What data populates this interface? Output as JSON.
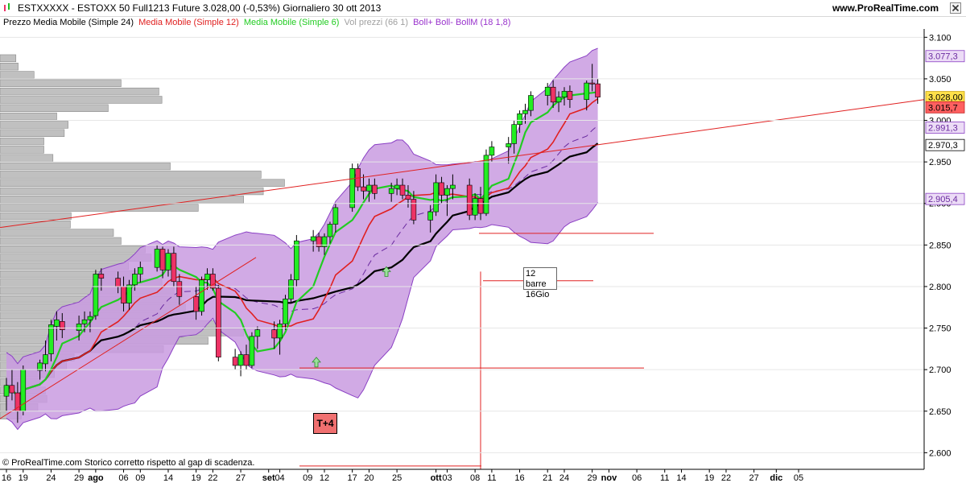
{
  "window": {
    "title": "ESTXXXXX - ESTOXX 50 Full1213 Future    3.028,00 (-0,53%)    Giornaliero  30 ott 2013",
    "site": "www.ProRealTime.com"
  },
  "legend": [
    {
      "text": "Prezzo Media Mobile (Simple 24)",
      "color": "#000000"
    },
    {
      "text": "Media Mobile (Simple 12)",
      "color": "#e02020"
    },
    {
      "text": "Media Mobile (Simple 6)",
      "color": "#22cc22"
    },
    {
      "text": "Vol prezzi (66 1)",
      "color": "#a0a0a0"
    },
    {
      "text": "Boll+ Boll- BollM (18 1,8)",
      "color": "#9933cc"
    }
  ],
  "footer_note": "© ProRealTime.com  Storico corretto rispetto al gap di scadenza.",
  "annotations": {
    "bars_box_line1": "12 barre",
    "bars_box_line2": "16Gio",
    "tplus": "T+4"
  },
  "colors": {
    "up": "#22ee22",
    "down": "#ee3366",
    "band_fill": "#c99be0",
    "band_line": "#8a3fc4",
    "sma6": "#22cc22",
    "sma12": "#e02020",
    "sma24": "#000000",
    "volume": "#c0c0c0",
    "trendline": "#e02020"
  },
  "chart_data": {
    "type": "candlestick",
    "y_axis": {
      "min": 2580,
      "max": 3110,
      "ticks": [
        2600,
        2650,
        2700,
        2750,
        2800,
        2850,
        2900,
        2950,
        3000,
        3050,
        3100
      ],
      "tick_labels": [
        "2.600",
        "2.650",
        "2.700",
        "2.750",
        "2.800",
        "2.850",
        "2.900",
        "2.950",
        "3.000",
        "3.050",
        "3.100"
      ]
    },
    "x_axis": {
      "labels": [
        {
          "text": "16",
          "day": 0
        },
        {
          "text": "19",
          "day": 3
        },
        {
          "text": "24",
          "day": 8
        },
        {
          "text": "29",
          "day": 13
        },
        {
          "text": "ago",
          "day": 16,
          "bold": true
        },
        {
          "text": "06",
          "day": 21
        },
        {
          "text": "09",
          "day": 24
        },
        {
          "text": "14",
          "day": 29
        },
        {
          "text": "19",
          "day": 34
        },
        {
          "text": "22",
          "day": 37
        },
        {
          "text": "27",
          "day": 42
        },
        {
          "text": "set",
          "day": 47,
          "bold": true
        },
        {
          "text": "04",
          "day": 49
        },
        {
          "text": "09",
          "day": 54
        },
        {
          "text": "12",
          "day": 57
        },
        {
          "text": "17",
          "day": 62
        },
        {
          "text": "20",
          "day": 65
        },
        {
          "text": "25",
          "day": 70
        },
        {
          "text": "ott",
          "day": 77,
          "bold": true
        },
        {
          "text": "03",
          "day": 79
        },
        {
          "text": "08",
          "day": 84
        },
        {
          "text": "11",
          "day": 87
        },
        {
          "text": "16",
          "day": 92
        },
        {
          "text": "21",
          "day": 97
        },
        {
          "text": "24",
          "day": 100
        },
        {
          "text": "29",
          "day": 105
        },
        {
          "text": "nov",
          "day": 108,
          "bold": true
        },
        {
          "text": "06",
          "day": 113
        },
        {
          "text": "11",
          "day": 118
        },
        {
          "text": "14",
          "day": 121
        },
        {
          "text": "19",
          "day": 126
        },
        {
          "text": "22",
          "day": 129
        },
        {
          "text": "27",
          "day": 134
        },
        {
          "text": "dic",
          "day": 138,
          "bold": true
        },
        {
          "text": "05",
          "day": 142
        }
      ],
      "start_date": "16 lug 2013"
    },
    "price_labels": [
      {
        "value": 3077.3,
        "text": "3.077,3",
        "style": "boll"
      },
      {
        "value": 3028.0,
        "text": "3.028,00",
        "style": "price"
      },
      {
        "value": 3015.7,
        "text": "3.015,7",
        "style": "sma"
      },
      {
        "value": 2991.3,
        "text": "2.991,3",
        "style": "boll"
      },
      {
        "value": 2970.3,
        "text": "2.970,3",
        "style": "plain"
      },
      {
        "value": 2905.4,
        "text": "2.905,4",
        "style": "boll"
      }
    ],
    "candles": [
      {
        "date": "16 lug",
        "o": 2668,
        "h": 2690,
        "l": 2650,
        "c": 2681
      },
      {
        "date": "17 lug",
        "o": 2681,
        "h": 2700,
        "l": 2663,
        "c": 2672
      },
      {
        "date": "18 lug",
        "o": 2672,
        "h": 2685,
        "l": 2636,
        "c": 2650
      },
      {
        "date": "19 lug",
        "o": 2650,
        "h": 2705,
        "l": 2645,
        "c": 2700
      },
      {
        "date": "22 lug",
        "o": 2699,
        "h": 2712,
        "l": 2688,
        "c": 2708
      },
      {
        "date": "23 lug",
        "o": 2707,
        "h": 2735,
        "l": 2698,
        "c": 2718
      },
      {
        "date": "24 lug",
        "o": 2719,
        "h": 2760,
        "l": 2710,
        "c": 2754
      },
      {
        "date": "25 lug",
        "o": 2752,
        "h": 2770,
        "l": 2735,
        "c": 2760
      },
      {
        "date": "26 lug",
        "o": 2758,
        "h": 2768,
        "l": 2738,
        "c": 2748
      },
      {
        "date": "29 lug",
        "o": 2747,
        "h": 2765,
        "l": 2735,
        "c": 2755
      },
      {
        "date": "30 lug",
        "o": 2755,
        "h": 2770,
        "l": 2745,
        "c": 2760
      },
      {
        "date": "31 lug",
        "o": 2760,
        "h": 2770,
        "l": 2745,
        "c": 2764
      },
      {
        "date": "01 ago",
        "o": 2765,
        "h": 2820,
        "l": 2760,
        "c": 2815
      },
      {
        "date": "02 ago",
        "o": 2815,
        "h": 2822,
        "l": 2795,
        "c": 2810
      },
      {
        "date": "05 ago",
        "o": 2810,
        "h": 2818,
        "l": 2792,
        "c": 2800
      },
      {
        "date": "06 ago",
        "o": 2800,
        "h": 2812,
        "l": 2770,
        "c": 2780
      },
      {
        "date": "07 ago",
        "o": 2780,
        "h": 2808,
        "l": 2772,
        "c": 2802
      },
      {
        "date": "08 ago",
        "o": 2802,
        "h": 2822,
        "l": 2795,
        "c": 2815
      },
      {
        "date": "09 ago",
        "o": 2815,
        "h": 2830,
        "l": 2805,
        "c": 2823
      },
      {
        "date": "12 ago",
        "o": 2823,
        "h": 2850,
        "l": 2818,
        "c": 2845
      },
      {
        "date": "13 ago",
        "o": 2845,
        "h": 2848,
        "l": 2810,
        "c": 2820
      },
      {
        "date": "14 ago",
        "o": 2820,
        "h": 2845,
        "l": 2812,
        "c": 2840
      },
      {
        "date": "15 ago",
        "o": 2840,
        "h": 2848,
        "l": 2800,
        "c": 2806
      },
      {
        "date": "16 ago",
        "o": 2806,
        "h": 2815,
        "l": 2778,
        "c": 2788
      },
      {
        "date": "19 ago",
        "o": 2788,
        "h": 2800,
        "l": 2760,
        "c": 2770
      },
      {
        "date": "20 ago",
        "o": 2770,
        "h": 2812,
        "l": 2765,
        "c": 2808
      },
      {
        "date": "21 ago",
        "o": 2808,
        "h": 2822,
        "l": 2796,
        "c": 2815
      },
      {
        "date": "22 ago",
        "o": 2815,
        "h": 2822,
        "l": 2795,
        "c": 2798
      },
      {
        "date": "23 ago",
        "o": 2798,
        "h": 2802,
        "l": 2710,
        "c": 2715
      },
      {
        "date": "26 ago",
        "o": 2715,
        "h": 2725,
        "l": 2700,
        "c": 2705
      },
      {
        "date": "27 ago",
        "o": 2705,
        "h": 2722,
        "l": 2692,
        "c": 2718
      },
      {
        "date": "28 ago",
        "o": 2718,
        "h": 2730,
        "l": 2700,
        "c": 2705
      },
      {
        "date": "29 ago",
        "o": 2705,
        "h": 2745,
        "l": 2702,
        "c": 2740
      },
      {
        "date": "30 ago",
        "o": 2740,
        "h": 2752,
        "l": 2725,
        "c": 2748
      },
      {
        "date": "02 set",
        "o": 2748,
        "h": 2758,
        "l": 2725,
        "c": 2738
      },
      {
        "date": "03 set",
        "o": 2738,
        "h": 2760,
        "l": 2718,
        "c": 2755
      },
      {
        "date": "04 set",
        "o": 2755,
        "h": 2790,
        "l": 2748,
        "c": 2785
      },
      {
        "date": "05 set",
        "o": 2785,
        "h": 2815,
        "l": 2780,
        "c": 2808
      },
      {
        "date": "06 set",
        "o": 2808,
        "h": 2862,
        "l": 2800,
        "c": 2855
      },
      {
        "date": "09 set",
        "o": 2855,
        "h": 2868,
        "l": 2842,
        "c": 2860
      },
      {
        "date": "10 set",
        "o": 2860,
        "h": 2865,
        "l": 2842,
        "c": 2848
      },
      {
        "date": "11 set",
        "o": 2848,
        "h": 2864,
        "l": 2838,
        "c": 2860
      },
      {
        "date": "12 set",
        "o": 2860,
        "h": 2878,
        "l": 2852,
        "c": 2875
      },
      {
        "date": "13 set",
        "o": 2875,
        "h": 2900,
        "l": 2865,
        "c": 2895
      },
      {
        "date": "16 set",
        "o": 2895,
        "h": 2948,
        "l": 2890,
        "c": 2942
      },
      {
        "date": "17 set",
        "o": 2942,
        "h": 2948,
        "l": 2915,
        "c": 2920
      },
      {
        "date": "18 set",
        "o": 2920,
        "h": 2935,
        "l": 2905,
        "c": 2915
      },
      {
        "date": "19 set",
        "o": 2915,
        "h": 2930,
        "l": 2902,
        "c": 2922
      },
      {
        "date": "20 set",
        "o": 2922,
        "h": 2930,
        "l": 2905,
        "c": 2912
      },
      {
        "date": "23 set",
        "o": 2912,
        "h": 2925,
        "l": 2902,
        "c": 2918
      },
      {
        "date": "24 set",
        "o": 2918,
        "h": 2930,
        "l": 2910,
        "c": 2922
      },
      {
        "date": "25 set",
        "o": 2922,
        "h": 2930,
        "l": 2905,
        "c": 2910
      },
      {
        "date": "26 set",
        "o": 2910,
        "h": 2922,
        "l": 2895,
        "c": 2905
      },
      {
        "date": "27 set",
        "o": 2905,
        "h": 2915,
        "l": 2875,
        "c": 2880
      },
      {
        "date": "30 set",
        "o": 2880,
        "h": 2898,
        "l": 2865,
        "c": 2890
      },
      {
        "date": "01 ott",
        "o": 2890,
        "h": 2935,
        "l": 2885,
        "c": 2925
      },
      {
        "date": "02 ott",
        "o": 2925,
        "h": 2932,
        "l": 2900,
        "c": 2910
      },
      {
        "date": "03 ott",
        "o": 2910,
        "h": 2922,
        "l": 2885,
        "c": 2918
      },
      {
        "date": "04 ott",
        "o": 2918,
        "h": 2935,
        "l": 2905,
        "c": 2922
      },
      {
        "date": "07 ott",
        "o": 2922,
        "h": 2930,
        "l": 2880,
        "c": 2886
      },
      {
        "date": "08 ott",
        "o": 2886,
        "h": 2912,
        "l": 2880,
        "c": 2906
      },
      {
        "date": "09 ott",
        "o": 2906,
        "h": 2920,
        "l": 2880,
        "c": 2888
      },
      {
        "date": "10 ott",
        "o": 2888,
        "h": 2965,
        "l": 2885,
        "c": 2958
      },
      {
        "date": "11 ott",
        "o": 2958,
        "h": 2975,
        "l": 2950,
        "c": 2968
      },
      {
        "date": "14 ott",
        "o": 2968,
        "h": 2980,
        "l": 2948,
        "c": 2972
      },
      {
        "date": "15 ott",
        "o": 2972,
        "h": 3000,
        "l": 2960,
        "c": 2995
      },
      {
        "date": "16 ott",
        "o": 2995,
        "h": 3012,
        "l": 2985,
        "c": 3008
      },
      {
        "date": "17 ott",
        "o": 3008,
        "h": 3020,
        "l": 2996,
        "c": 3012
      },
      {
        "date": "18 ott",
        "o": 3012,
        "h": 3035,
        "l": 3005,
        "c": 3030
      },
      {
        "date": "21 ott",
        "o": 3030,
        "h": 3045,
        "l": 3018,
        "c": 3040
      },
      {
        "date": "22 ott",
        "o": 3040,
        "h": 3048,
        "l": 3015,
        "c": 3022
      },
      {
        "date": "23 ott",
        "o": 3022,
        "h": 3035,
        "l": 3010,
        "c": 3028
      },
      {
        "date": "24 ott",
        "o": 3028,
        "h": 3040,
        "l": 3018,
        "c": 3035
      },
      {
        "date": "25 ott",
        "o": 3035,
        "h": 3042,
        "l": 3015,
        "c": 3025
      },
      {
        "date": "28 ott",
        "o": 3025,
        "h": 3048,
        "l": 3012,
        "c": 3045
      },
      {
        "date": "29 ott",
        "o": 3045,
        "h": 3068,
        "l": 3035,
        "c": 3044
      },
      {
        "date": "30 ott",
        "o": 3044,
        "h": 3050,
        "l": 3020,
        "c": 3028
      }
    ],
    "volume_profile": [
      {
        "price": 3075,
        "volume": 21
      },
      {
        "price": 3065,
        "volume": 24
      },
      {
        "price": 3055,
        "volume": 45
      },
      {
        "price": 3045,
        "volume": 160
      },
      {
        "price": 3035,
        "volume": 210
      },
      {
        "price": 3025,
        "volume": 214
      },
      {
        "price": 3015,
        "volume": 143
      },
      {
        "price": 3005,
        "volume": 75
      },
      {
        "price": 2995,
        "volume": 90
      },
      {
        "price": 2985,
        "volume": 85
      },
      {
        "price": 2975,
        "volume": 58
      },
      {
        "price": 2965,
        "volume": 58
      },
      {
        "price": 2955,
        "volume": 70
      },
      {
        "price": 2945,
        "volume": 225
      },
      {
        "price": 2935,
        "volume": 345
      },
      {
        "price": 2925,
        "volume": 376
      },
      {
        "price": 2915,
        "volume": 348
      },
      {
        "price": 2905,
        "volume": 322
      },
      {
        "price": 2895,
        "volume": 262
      },
      {
        "price": 2885,
        "volume": 94
      },
      {
        "price": 2875,
        "volume": 93
      },
      {
        "price": 2865,
        "volume": 150
      },
      {
        "price": 2855,
        "volume": 160
      },
      {
        "price": 2845,
        "volume": 192
      },
      {
        "price": 2835,
        "volume": 200
      },
      {
        "price": 2825,
        "volume": 170
      },
      {
        "price": 2815,
        "volume": 188
      },
      {
        "price": 2805,
        "volume": 214
      },
      {
        "price": 2795,
        "volume": 230
      },
      {
        "price": 2785,
        "volume": 240
      },
      {
        "price": 2775,
        "volume": 245
      },
      {
        "price": 2765,
        "volume": 258
      },
      {
        "price": 2755,
        "volume": 290
      },
      {
        "price": 2745,
        "volume": 322
      },
      {
        "price": 2735,
        "volume": 275
      },
      {
        "price": 2725,
        "volume": 216
      },
      {
        "price": 2715,
        "volume": 98
      },
      {
        "price": 2705,
        "volume": 88
      },
      {
        "price": 2695,
        "volume": 72
      },
      {
        "price": 2685,
        "volume": 53
      },
      {
        "price": 2675,
        "volume": 60
      },
      {
        "price": 2665,
        "volume": 62
      },
      {
        "price": 2655,
        "volume": 50
      },
      {
        "price": 2645,
        "volume": 28
      }
    ]
  }
}
